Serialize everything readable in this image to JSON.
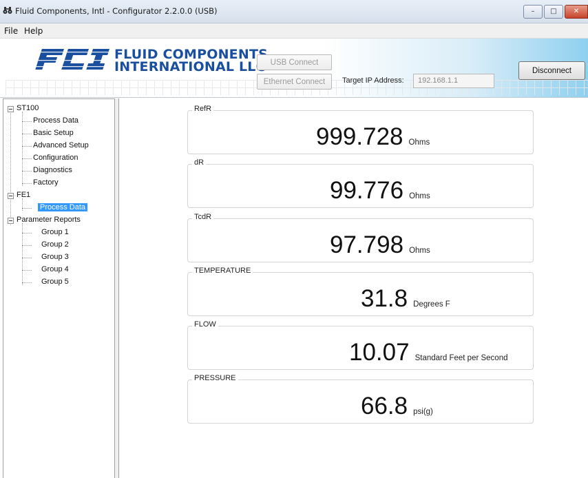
{
  "window": {
    "title": "Fluid Components, Intl - Configurator 2.2.0.0 (USB)",
    "minimize_glyph": "–",
    "maximize_glyph": "□",
    "close_glyph": "✕"
  },
  "menu": {
    "file": "File",
    "help": "Help"
  },
  "header": {
    "logo_line1": "FLUID COMPONENTS",
    "logo_line2": "INTERNATIONAL LLC",
    "logo_mark": "FCI",
    "usb_connect": "USB Connect",
    "ethernet_connect": "Ethernet Connect",
    "ip_label": "Target IP Address:",
    "ip_value": "192.168.1.1",
    "disconnect": "Disconnect"
  },
  "tree": {
    "st100": "ST100",
    "st100_children": [
      "Process Data",
      "Basic Setup",
      "Advanced Setup",
      "Configuration",
      "Diagnostics",
      "Factory"
    ],
    "fe1": "FE1",
    "fe1_children": [
      "Process Data"
    ],
    "reports": "Parameter Reports",
    "reports_children": [
      "Group 1",
      "Group 2",
      "Group 3",
      "Group 4",
      "Group 5"
    ],
    "selected": "FE1 / Process Data"
  },
  "readings": [
    {
      "label": "RefR",
      "value": "999.728",
      "unit": "Ohms"
    },
    {
      "label": "dR",
      "value": "99.776",
      "unit": "Ohms"
    },
    {
      "label": "TcdR",
      "value": "97.798",
      "unit": "Ohms"
    },
    {
      "label": "TEMPERATURE",
      "value": "31.8",
      "unit": "Degrees F"
    },
    {
      "label": "FLOW",
      "value": "10.07",
      "unit": "Standard Feet per Second"
    },
    {
      "label": "PRESSURE",
      "value": "66.8",
      "unit": "psi(g)"
    }
  ],
  "colors": {
    "accent": "#1a4fa0",
    "selection": "#3399ff",
    "banner_blue": "#8fd0ef"
  }
}
